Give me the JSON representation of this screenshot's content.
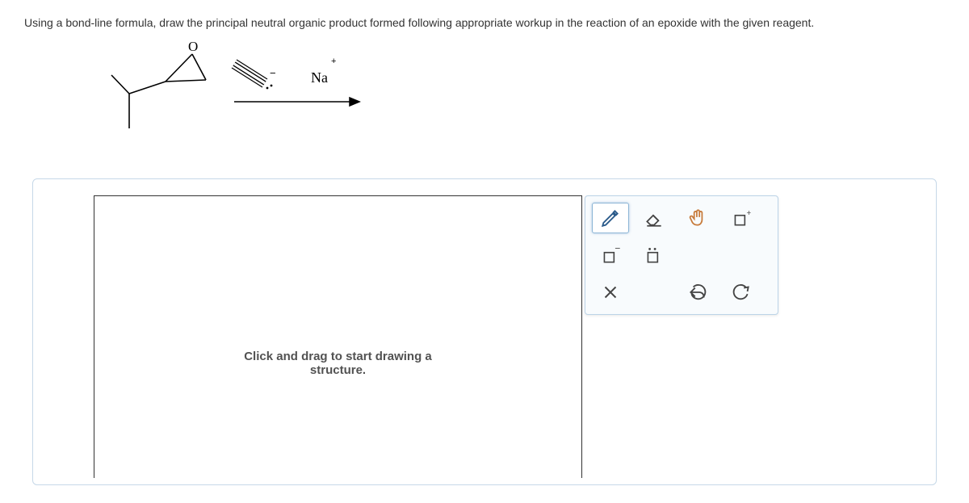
{
  "question": "Using a bond-line formula, draw the principal neutral organic product formed following appropriate workup in the reaction of an epoxide with the given reagent.",
  "reagent": {
    "na_label": "Na",
    "plus_symbol": "+"
  },
  "canvas": {
    "placeholder": "Click and drag to start drawing a\nstructure."
  },
  "tools": {
    "pencil": "pencil-icon",
    "eraser": "eraser-icon",
    "hand": "hand-icon",
    "plus_charge": "plus-charge-icon",
    "minus_charge": "minus-charge-icon",
    "lone_pair": "lone-pair-icon",
    "clear": "clear-icon",
    "undo": "undo-icon",
    "redo": "redo-icon"
  }
}
